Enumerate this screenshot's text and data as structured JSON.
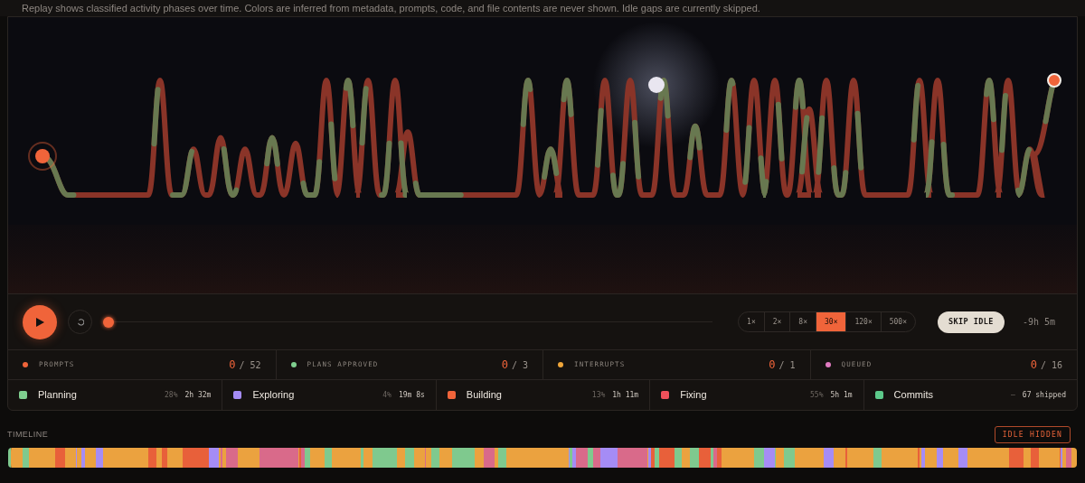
{
  "description": "Replay shows classified activity phases over time. Colors are inferred from metadata, prompts, code, and file contents are never shown. Idle gaps are currently skipped.",
  "playback": {
    "level": 0,
    "speeds": [
      {
        "label": "1×",
        "selected": false
      },
      {
        "label": "2×",
        "selected": false
      },
      {
        "label": "8×",
        "selected": false
      },
      {
        "label": "30×",
        "selected": true
      },
      {
        "label": "120×",
        "selected": false
      },
      {
        "label": "500×",
        "selected": false
      }
    ],
    "skip_idle": "SKIP IDLE",
    "remaining": "-9h 5m"
  },
  "counters": [
    {
      "label": "PROMPTS",
      "color": "#f0643a",
      "current": "0",
      "total": "/ 52"
    },
    {
      "label": "PLANS APPROVED",
      "color": "#7fcf8f",
      "current": "0",
      "total": "/ 3"
    },
    {
      "label": "INTERRUPTS",
      "color": "#f0a63a",
      "current": "0",
      "total": "/ 1"
    },
    {
      "label": "QUEUED",
      "color": "#e07ac0",
      "current": "0",
      "total": "/ 16"
    }
  ],
  "phases": [
    {
      "label": "Planning",
      "color": "#7fcf8f",
      "percent": "28%",
      "duration": "2h 32m"
    },
    {
      "label": "Exploring",
      "color": "#a58cf5",
      "percent": "4%",
      "duration": "19m 8s"
    },
    {
      "label": "Building",
      "color": "#f0643a",
      "percent": "13%",
      "duration": "1h 11m"
    },
    {
      "label": "Fixing",
      "color": "#f0505a",
      "percent": "55%",
      "duration": "5h 1m"
    },
    {
      "label": "Commits",
      "color": "#5cc98a",
      "percent": "—",
      "duration": "67 shipped"
    }
  ],
  "timeline": {
    "title": "TIMELINE",
    "idle_button": "IDLE HIDDEN"
  }
}
